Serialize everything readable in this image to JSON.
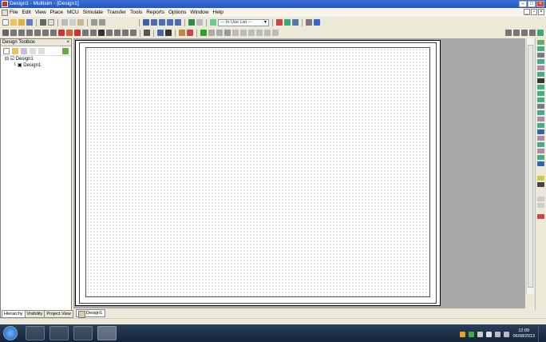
{
  "window": {
    "title": "Design1 - Multisim - [Design1]"
  },
  "menu": [
    "File",
    "Edit",
    "View",
    "Place",
    "MCU",
    "Simulate",
    "Transfer",
    "Tools",
    "Reports",
    "Options",
    "Window",
    "Help"
  ],
  "toolbar": {
    "in_use_list": "--- In Use List ---"
  },
  "toolbox": {
    "title": "Design Toolbox",
    "close": "×",
    "tree": {
      "root": "Design1",
      "child": "Design1"
    },
    "tabs": [
      "Hierarchy",
      "Visibility",
      "Project View"
    ],
    "active_tab": "Hierarchy"
  },
  "document_tab": "Design1",
  "taskbar": {
    "time": "12:09",
    "date": "06/08/2013"
  },
  "colors": {
    "title_bar": "#2456c0",
    "workspace": "#a9a9a9",
    "taskbar": "#14243a"
  }
}
